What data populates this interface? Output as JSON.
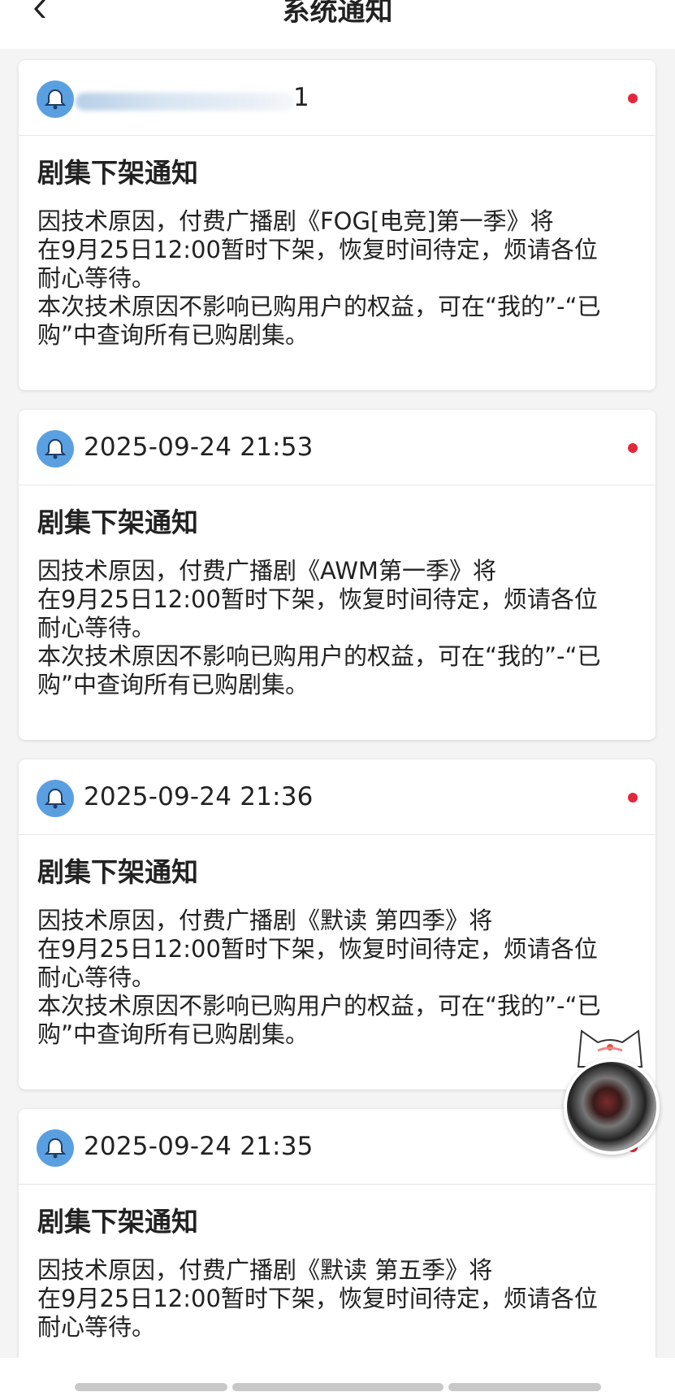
{
  "header": {
    "title": "系统通知"
  },
  "notices": [
    {
      "timestamp": "1",
      "title": "剧集下架通知",
      "lines": [
        "因技术原因，付费广播剧《FOG[电竞]第一季》将",
        "在9月25日12:00暂时下架，恢复时间待定，烦请各位",
        "耐心等待。",
        "本次技术原因不影响已购用户的权益，可在“我的”-“已",
        "购”中查询所有已购剧集。"
      ]
    },
    {
      "timestamp": "2025-09-24 21:53",
      "title": "剧集下架通知",
      "lines": [
        "因技术原因，付费广播剧《AWM第一季》将",
        "在9月25日12:00暂时下架，恢复时间待定，烦请各位",
        "耐心等待。",
        "本次技术原因不影响已购用户的权益，可在“我的”-“已",
        "购”中查询所有已购剧集。"
      ]
    },
    {
      "timestamp": "2025-09-24 21:36",
      "title": "剧集下架通知",
      "lines": [
        "因技术原因，付费广播剧《默读 第四季》将",
        "在9月25日12:00暂时下架，恢复时间待定，烦请各位",
        "耐心等待。",
        "本次技术原因不影响已购用户的权益，可在“我的”-“已",
        "购”中查询所有已购剧集。"
      ]
    },
    {
      "timestamp": "2025-09-24 21:35",
      "title": "剧集下架通知",
      "lines": [
        "因技术原因，付费广播剧《默读 第五季》将",
        "在9月25日12:00暂时下架，恢复时间待定，烦请各位",
        "耐心等待。"
      ]
    }
  ],
  "colors": {
    "accent": "#5aa0e0",
    "unread_dot": "#e4283b",
    "background": "#f4f4f4"
  },
  "icons": {
    "back": "chevron-left-icon",
    "notice": "bell-icon",
    "unread": "red-dot"
  }
}
